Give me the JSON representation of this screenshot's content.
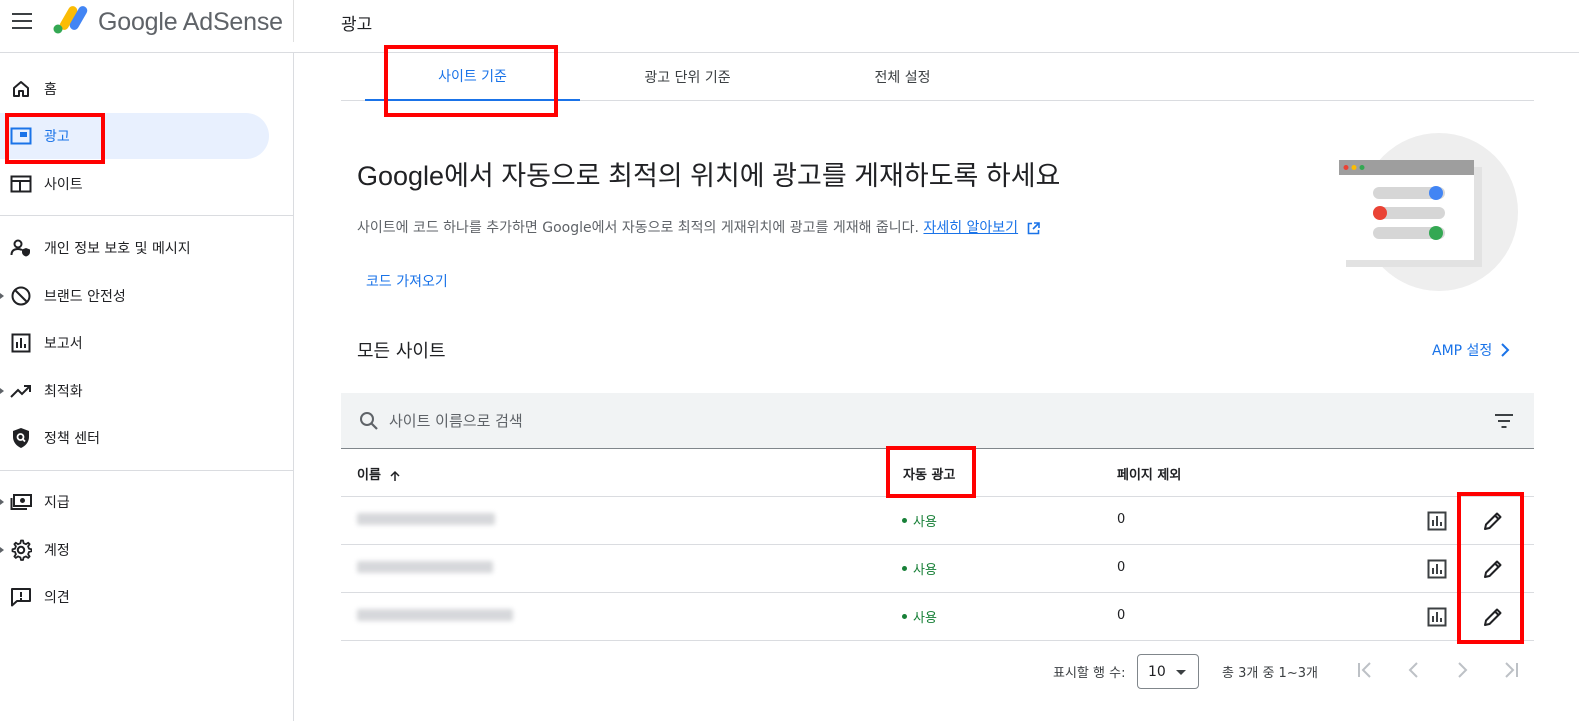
{
  "app": {
    "brand": "Google AdSense",
    "page_title": "광고"
  },
  "sidebar": {
    "items": [
      {
        "label": "홈",
        "icon": "home-icon"
      },
      {
        "label": "광고",
        "icon": "ads-icon",
        "active": true
      },
      {
        "label": "사이트",
        "icon": "sites-icon"
      },
      {
        "label": "개인 정보 보호 및 메시지",
        "icon": "privacy-icon"
      },
      {
        "label": "브랜드 안전성",
        "icon": "block-icon"
      },
      {
        "label": "보고서",
        "icon": "reports-icon"
      },
      {
        "label": "최적화",
        "icon": "optimize-icon"
      },
      {
        "label": "정책 센터",
        "icon": "policy-icon"
      },
      {
        "label": "지급",
        "icon": "payments-icon"
      },
      {
        "label": "계정",
        "icon": "gear-icon"
      },
      {
        "label": "의견",
        "icon": "feedback-icon"
      }
    ]
  },
  "tabs": [
    {
      "label": "사이트 기준",
      "active": true
    },
    {
      "label": "광고 단위 기준"
    },
    {
      "label": "전체 설정"
    }
  ],
  "hero": {
    "title": "Google에서 자동으로 최적의 위치에 광고를 게재하도록 하세요",
    "description": "사이트에 코드 하나를 추가하면 Google에서 자동으로 최적의 게재위치에 광고를 게재해 줍니다.",
    "learn_more": "자세히 알아보기",
    "get_code": "코드 가져오기"
  },
  "section": {
    "title": "모든 사이트",
    "amp_link": "AMP 설정"
  },
  "search": {
    "placeholder": "사이트 이름으로 검색"
  },
  "table": {
    "headers": {
      "name": "이름",
      "auto_ads": "자동 광고",
      "page_exclusions": "페이지 제외"
    },
    "rows": [
      {
        "status": "사용",
        "exclusions": "0"
      },
      {
        "status": "사용",
        "exclusions": "0"
      },
      {
        "status": "사용",
        "exclusions": "0"
      }
    ]
  },
  "pagination": {
    "rows_label": "표시할 행 수:",
    "rows_value": "10",
    "range": "총 3개 중 1~3개"
  },
  "colors": {
    "accent": "#1a73e8",
    "active_bg": "#e8f0fe",
    "status_green": "#188038",
    "highlight": "#ff0000"
  }
}
